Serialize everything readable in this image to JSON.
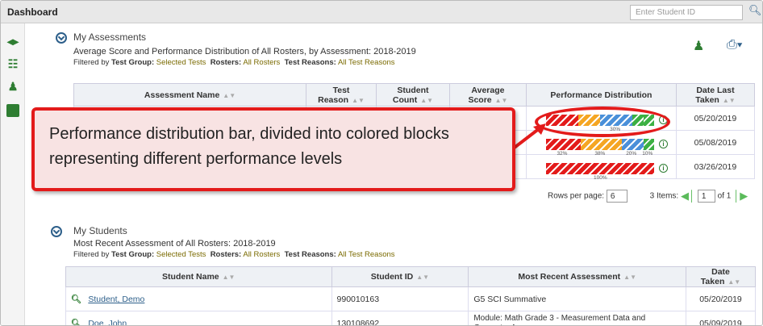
{
  "app": {
    "title": "Dashboard",
    "search_placeholder": "Enter Student ID"
  },
  "assessments": {
    "heading": "My Assessments",
    "subtitle": "Average Score and Performance Distribution of All Rosters, by Assessment: 2018-2019",
    "filter": {
      "prefix": "Filtered by",
      "tg_label": "Test Group:",
      "tg_value": "Selected Tests",
      "ro_label": "Rosters:",
      "ro_value": "All Rosters",
      "tr_label": "Test Reasons:",
      "tr_value": "All Test Reasons"
    },
    "columns": [
      "Assessment Name",
      "Test Reason",
      "Student Count",
      "Average Score",
      "Performance Distribution",
      "Date Last Taken"
    ],
    "rows": [
      {
        "date": "05/20/2019",
        "dist": [
          30,
          20,
          30,
          10,
          10
        ],
        "labels": [
          "",
          "",
          "30%",
          "",
          ""
        ]
      },
      {
        "date": "05/08/2019",
        "dist": [
          32,
          38,
          20,
          10
        ],
        "labels": [
          "32%",
          "38%",
          "20%",
          "10%"
        ]
      },
      {
        "date": "03/26/2019",
        "dist": [
          100
        ],
        "labels": [
          "100%"
        ]
      }
    ],
    "pager": {
      "rows_label": "Rows per page:",
      "rows_value": "6",
      "items": "3 Items:",
      "page": "1",
      "of": "of 1"
    }
  },
  "students": {
    "heading": "My Students",
    "subtitle": "Most Recent Assessment of All Rosters: 2018-2019",
    "filter": {
      "prefix": "Filtered by",
      "tg_label": "Test Group:",
      "tg_value": "Selected Tests",
      "ro_label": "Rosters:",
      "ro_value": "All Rosters",
      "tr_label": "Test Reasons:",
      "tr_value": "All Test Reasons"
    },
    "columns": [
      "Student Name",
      "Student ID",
      "Most Recent Assessment",
      "Date Taken"
    ],
    "rows": [
      {
        "name": "Student, Demo",
        "id": "990010163",
        "assessment": "G5 SCI Summative",
        "date": "05/20/2019"
      },
      {
        "name": "Doe, John",
        "id": "130108692",
        "assessment": "Module: Math Grade 3 - Measurement Data and Geometry A",
        "date": "05/09/2019"
      }
    ]
  },
  "callout": {
    "text": "Performance distribution bar, divided into colored blocks representing different performance levels"
  },
  "colors": {
    "red": "#e31b1b",
    "orange": "#f5a623",
    "blue": "#4a90d9",
    "green": "#3cb043",
    "accent": "#2d5f8a"
  }
}
